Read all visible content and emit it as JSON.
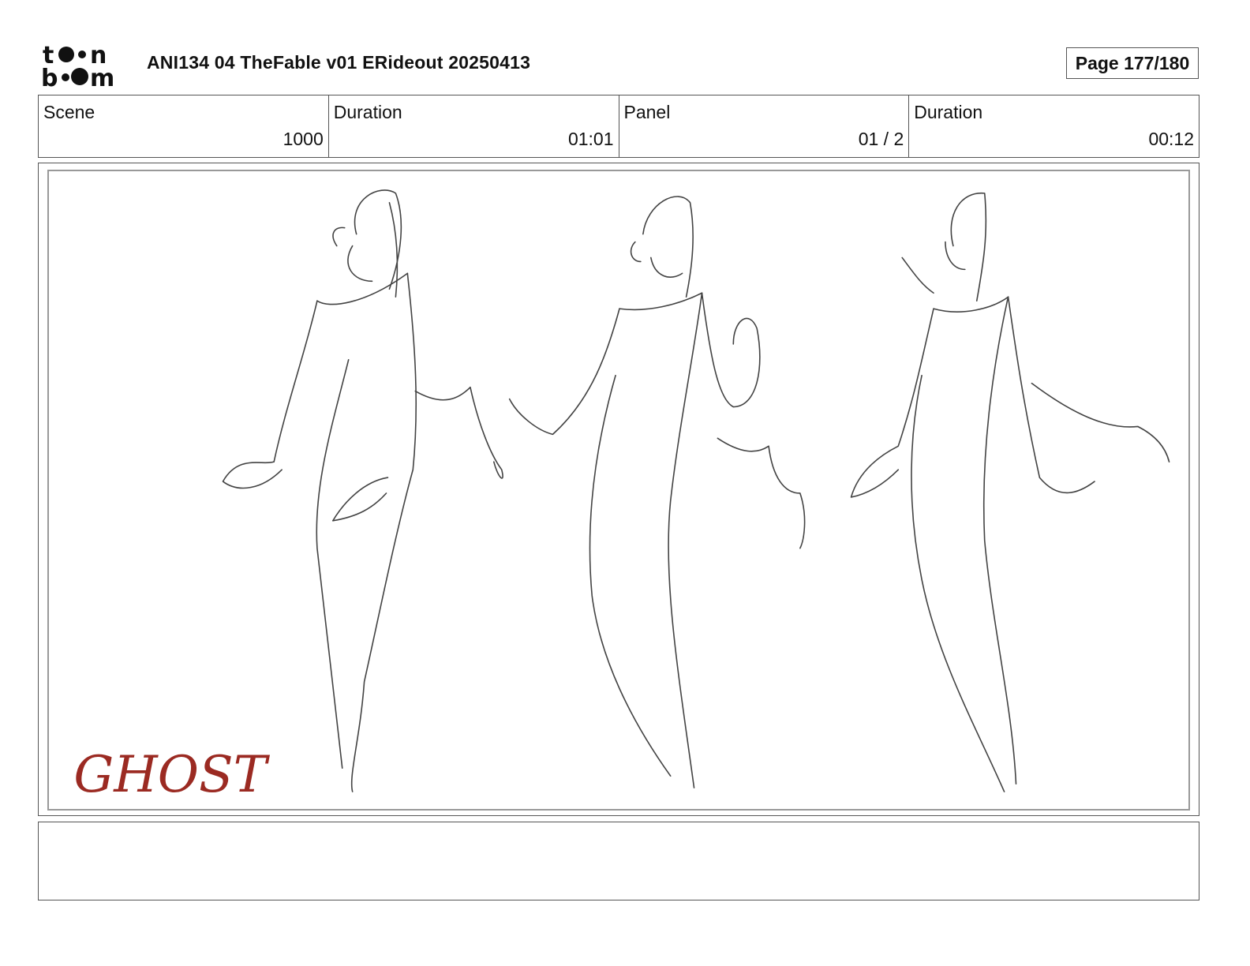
{
  "logo": {
    "text": "toonboom",
    "name": "toon-boom-logo"
  },
  "header": {
    "title": "ANI134 04 TheFable v01 ERideout 20250413",
    "page_label": "Page 177/180"
  },
  "info": {
    "scene_label": "Scene",
    "scene_value": "1000",
    "scene_duration_label": "Duration",
    "scene_duration_value": "01:01",
    "panel_label": "Panel",
    "panel_value": "01 / 2",
    "panel_duration_label": "Duration",
    "panel_duration_value": "00:12"
  },
  "panel": {
    "sketch": "ghost-character-turnaround-sketch",
    "annotation": "GHOST",
    "annotation_color": "#9b2a22"
  },
  "notes": {
    "text": ""
  }
}
